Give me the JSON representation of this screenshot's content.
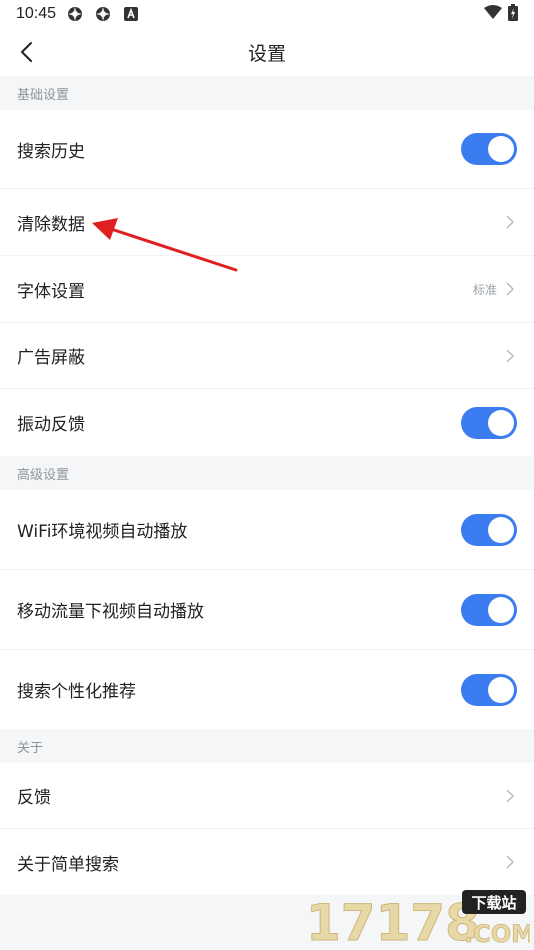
{
  "status_bar": {
    "time": "10:45",
    "icons": [
      "gear-icon",
      "gear-icon",
      "a-icon"
    ],
    "right_icons": [
      "wifi-icon",
      "battery-icon"
    ]
  },
  "header": {
    "title": "设置",
    "back_icon": "back-chevron-icon"
  },
  "sections": [
    {
      "label": "基础设置",
      "items": [
        {
          "label": "搜索历史",
          "control": "toggle",
          "on": true
        },
        {
          "label": "清除数据",
          "control": "chevron"
        },
        {
          "label": "字体设置",
          "control": "chevron",
          "value": "标准"
        },
        {
          "label": "广告屏蔽",
          "control": "chevron"
        },
        {
          "label": "振动反馈",
          "control": "toggle",
          "on": true
        }
      ]
    },
    {
      "label": "高级设置",
      "items": [
        {
          "label": "WiFi环境视频自动播放",
          "control": "toggle",
          "on": true
        },
        {
          "label": "移动流量下视频自动播放",
          "control": "toggle",
          "on": true
        },
        {
          "label": "搜索个性化推荐",
          "control": "toggle",
          "on": true
        }
      ]
    },
    {
      "label": "关于",
      "items": [
        {
          "label": "反馈",
          "control": "chevron"
        },
        {
          "label": "关于简单搜索",
          "control": "chevron"
        }
      ]
    }
  ],
  "annotation": {
    "color": "#e02020",
    "icon": "red-arrow-icon"
  },
  "watermark": {
    "text": "17178",
    "badge": "下载站",
    "suffix": ".COM"
  },
  "colors": {
    "accent": "#3b7cf0",
    "background": "#f5f6f8"
  }
}
